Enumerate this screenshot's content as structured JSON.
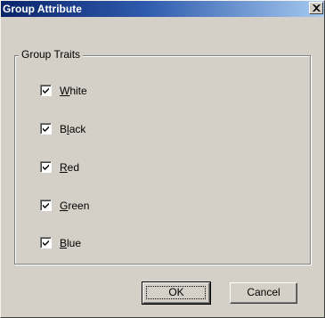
{
  "window": {
    "title": "Group Attribute",
    "close_label": "×"
  },
  "group": {
    "legend": "Group Traits",
    "items": [
      {
        "pre": "",
        "mnemonic": "W",
        "post": "hite",
        "checked": true
      },
      {
        "pre": "B",
        "mnemonic": "l",
        "post": "ack",
        "checked": true
      },
      {
        "pre": "",
        "mnemonic": "R",
        "post": "ed",
        "checked": true
      },
      {
        "pre": "",
        "mnemonic": "G",
        "post": "reen",
        "checked": true
      },
      {
        "pre": "",
        "mnemonic": "B",
        "post": "lue",
        "checked": true
      }
    ]
  },
  "buttons": {
    "ok_label": "OK",
    "cancel_label": "Cancel"
  },
  "colors": {
    "titlebar_start": "#0a246a",
    "titlebar_end": "#a6caf0",
    "face": "#d4d0c8"
  }
}
